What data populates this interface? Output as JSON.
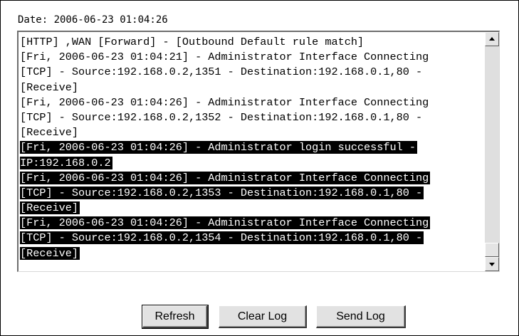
{
  "date_line": "Date: 2006-06-23 01:04:26",
  "log": {
    "lines": [
      {
        "text": "[HTTP] ,WAN [Forward] - [Outbound Default rule match]",
        "selected": false
      },
      {
        "text": "[Fri, 2006-06-23 01:04:21] - Administrator Interface Connecting",
        "selected": false
      },
      {
        "text": "[TCP] - Source:192.168.0.2,1351 - Destination:192.168.0.1,80 -",
        "selected": false
      },
      {
        "text": "[Receive]",
        "selected": false
      },
      {
        "text": "[Fri, 2006-06-23 01:04:26] - Administrator Interface Connecting",
        "selected": false
      },
      {
        "text": "[TCP] - Source:192.168.0.2,1352 - Destination:192.168.0.1,80 -",
        "selected": false
      },
      {
        "text": "[Receive]",
        "selected": false
      },
      {
        "text": "[Fri, 2006-06-23 01:04:26] - Administrator login successful -",
        "selected": true
      },
      {
        "text": "IP:192.168.0.2",
        "selected": true
      },
      {
        "text": "[Fri, 2006-06-23 01:04:26] - Administrator Interface Connecting",
        "selected": true
      },
      {
        "text": "[TCP] - Source:192.168.0.2,1353 - Destination:192.168.0.1,80 -",
        "selected": true
      },
      {
        "text": "[Receive]",
        "selected": true
      },
      {
        "text": "[Fri, 2006-06-23 01:04:26] - Administrator Interface Connecting",
        "selected": true
      },
      {
        "text": "[TCP] - Source:192.168.0.2,1354 - Destination:192.168.0.1,80 -",
        "selected": true
      },
      {
        "text": "[Receive]",
        "selected": true
      }
    ]
  },
  "buttons": {
    "refresh": "Refresh",
    "clear_log": "Clear Log",
    "send_log": "Send Log"
  },
  "icons": {
    "scroll_up": "triangle-up-icon",
    "scroll_down": "triangle-down-icon"
  }
}
